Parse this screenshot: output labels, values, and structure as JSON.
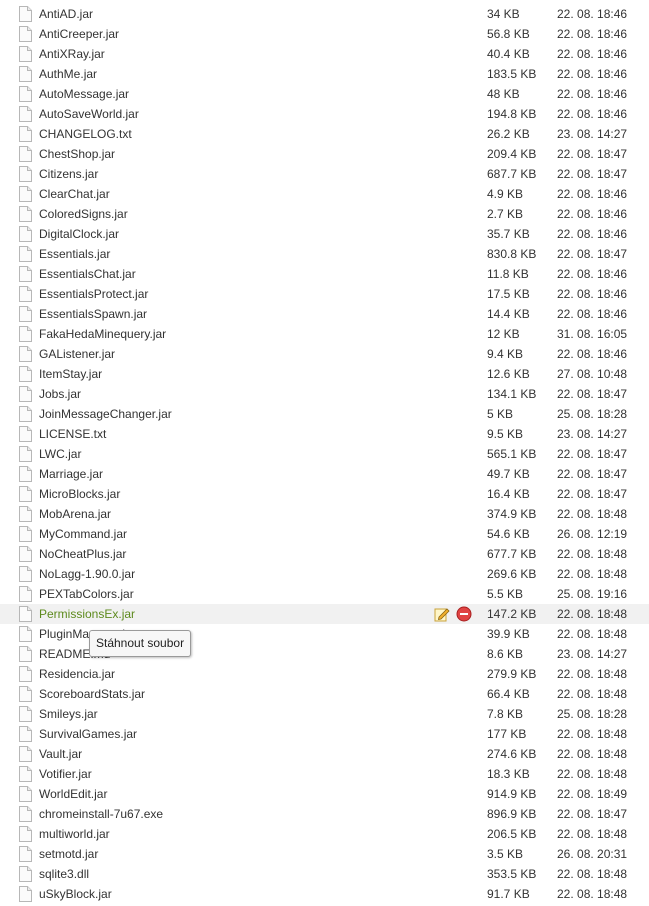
{
  "files": [
    {
      "name": "AntiAD.jar",
      "size": "34 KB",
      "date": "22. 08. 18:46"
    },
    {
      "name": "AntiCreeper.jar",
      "size": "56.8 KB",
      "date": "22. 08. 18:46"
    },
    {
      "name": "AntiXRay.jar",
      "size": "40.4 KB",
      "date": "22. 08. 18:46"
    },
    {
      "name": "AuthMe.jar",
      "size": "183.5 KB",
      "date": "22. 08. 18:46"
    },
    {
      "name": "AutoMessage.jar",
      "size": "48 KB",
      "date": "22. 08. 18:46"
    },
    {
      "name": "AutoSaveWorld.jar",
      "size": "194.8 KB",
      "date": "22. 08. 18:46"
    },
    {
      "name": "CHANGELOG.txt",
      "size": "26.2 KB",
      "date": "23. 08. 14:27"
    },
    {
      "name": "ChestShop.jar",
      "size": "209.4 KB",
      "date": "22. 08. 18:47"
    },
    {
      "name": "Citizens.jar",
      "size": "687.7 KB",
      "date": "22. 08. 18:47"
    },
    {
      "name": "ClearChat.jar",
      "size": "4.9 KB",
      "date": "22. 08. 18:46"
    },
    {
      "name": "ColoredSigns.jar",
      "size": "2.7 KB",
      "date": "22. 08. 18:46"
    },
    {
      "name": "DigitalClock.jar",
      "size": "35.7 KB",
      "date": "22. 08. 18:46"
    },
    {
      "name": "Essentials.jar",
      "size": "830.8 KB",
      "date": "22. 08. 18:47"
    },
    {
      "name": "EssentialsChat.jar",
      "size": "11.8 KB",
      "date": "22. 08. 18:46"
    },
    {
      "name": "EssentialsProtect.jar",
      "size": "17.5 KB",
      "date": "22. 08. 18:46"
    },
    {
      "name": "EssentialsSpawn.jar",
      "size": "14.4 KB",
      "date": "22. 08. 18:46"
    },
    {
      "name": "FakaHedaMinequery.jar",
      "size": "12 KB",
      "date": "31. 08. 16:05"
    },
    {
      "name": "GAListener.jar",
      "size": "9.4 KB",
      "date": "22. 08. 18:46"
    },
    {
      "name": "ItemStay.jar",
      "size": "12.6 KB",
      "date": "27. 08. 10:48"
    },
    {
      "name": "Jobs.jar",
      "size": "134.1 KB",
      "date": "22. 08. 18:47"
    },
    {
      "name": "JoinMessageChanger.jar",
      "size": "5 KB",
      "date": "25. 08. 18:28"
    },
    {
      "name": "LICENSE.txt",
      "size": "9.5 KB",
      "date": "23. 08. 14:27"
    },
    {
      "name": "LWC.jar",
      "size": "565.1 KB",
      "date": "22. 08. 18:47"
    },
    {
      "name": "Marriage.jar",
      "size": "49.7 KB",
      "date": "22. 08. 18:47"
    },
    {
      "name": "MicroBlocks.jar",
      "size": "16.4 KB",
      "date": "22. 08. 18:47"
    },
    {
      "name": "MobArena.jar",
      "size": "374.9 KB",
      "date": "22. 08. 18:48"
    },
    {
      "name": "MyCommand.jar",
      "size": "54.6 KB",
      "date": "26. 08. 12:19"
    },
    {
      "name": "NoCheatPlus.jar",
      "size": "677.7 KB",
      "date": "22. 08. 18:48"
    },
    {
      "name": "NoLagg-1.90.0.jar",
      "size": "269.6 KB",
      "date": "22. 08. 18:48"
    },
    {
      "name": "PEXTabColors.jar",
      "size": "5.5 KB",
      "date": "25. 08. 19:16"
    },
    {
      "name": "PermissionsEx.jar",
      "size": "147.2 KB",
      "date": "22. 08. 18:48"
    },
    {
      "name": "PluginManager.jar",
      "size": "39.9 KB",
      "date": "22. 08. 18:48"
    },
    {
      "name": "README.md",
      "size": "8.6 KB",
      "date": "23. 08. 14:27"
    },
    {
      "name": "Residencia.jar",
      "size": "279.9 KB",
      "date": "22. 08. 18:48"
    },
    {
      "name": "ScoreboardStats.jar",
      "size": "66.4 KB",
      "date": "22. 08. 18:48"
    },
    {
      "name": "Smileys.jar",
      "size": "7.8 KB",
      "date": "25. 08. 18:28"
    },
    {
      "name": "SurvivalGames.jar",
      "size": "177 KB",
      "date": "22. 08. 18:48"
    },
    {
      "name": "Vault.jar",
      "size": "274.6 KB",
      "date": "22. 08. 18:48"
    },
    {
      "name": "Votifier.jar",
      "size": "18.3 KB",
      "date": "22. 08. 18:48"
    },
    {
      "name": "WorldEdit.jar",
      "size": "914.9 KB",
      "date": "22. 08. 18:49"
    },
    {
      "name": "chromeinstall-7u67.exe",
      "size": "896.9 KB",
      "date": "22. 08. 18:47"
    },
    {
      "name": "multiworld.jar",
      "size": "206.5 KB",
      "date": "22. 08. 18:48"
    },
    {
      "name": "setmotd.jar",
      "size": "3.5 KB",
      "date": "26. 08. 20:31"
    },
    {
      "name": "sqlite3.dll",
      "size": "353.5 KB",
      "date": "22. 08. 18:48"
    },
    {
      "name": "uSkyBlock.jar",
      "size": "91.7 KB",
      "date": "22. 08. 18:48"
    }
  ],
  "hovered_row_index": 30,
  "tooltip": {
    "text": "Stáhnout soubor"
  },
  "icons": {
    "file": "file-icon",
    "edit": "pencil-icon",
    "delete": "delete-icon"
  },
  "colors": {
    "hover_name": "#5d8a1d",
    "hover_bg": "#f1f1f1",
    "delete": "#e04343"
  }
}
